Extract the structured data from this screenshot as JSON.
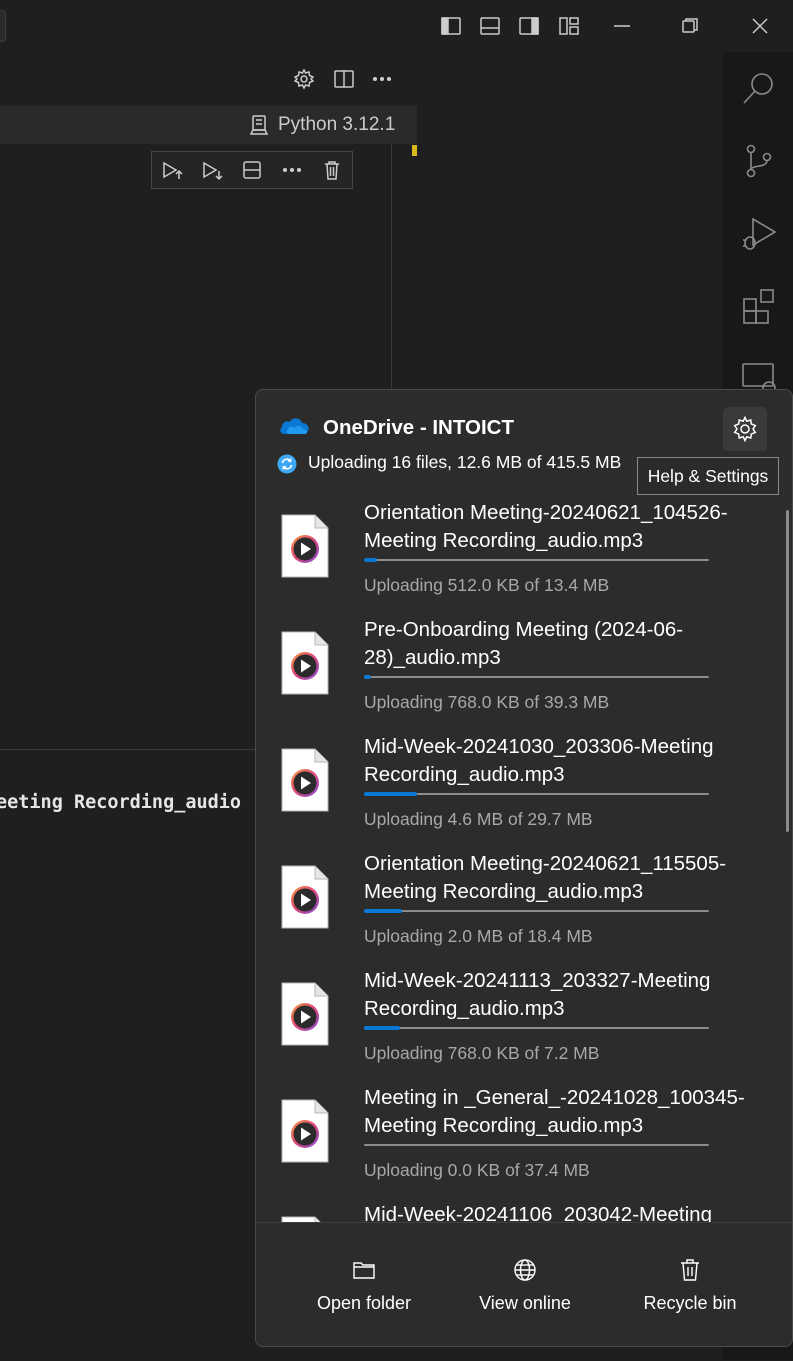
{
  "vscode": {
    "kernel_label": "Python 3.12.1",
    "output_fragment": "eeting Recording_audio"
  },
  "onedrive": {
    "title": "OneDrive - INTOICT",
    "status": "Uploading 16 files, 12.6 MB of 415.5 MB",
    "settings_tooltip": "Help & Settings",
    "files": [
      {
        "name": "Orientation Meeting-20240621_104526-Meeting Recording_audio.mp3",
        "status": "Uploading 512.0 KB of 13.4 MB",
        "progress": 0.037
      },
      {
        "name": "Pre-Onboarding Meeting (2024-06-28)_audio.mp3",
        "status": "Uploading 768.0 KB of 39.3 MB",
        "progress": 0.019
      },
      {
        "name": "Mid-Week-20241030_203306-Meeting Recording_audio.mp3",
        "status": "Uploading 4.6 MB of 29.7 MB",
        "progress": 0.155
      },
      {
        "name": "Orientation Meeting-20240621_115505-Meeting Recording_audio.mp3",
        "status": "Uploading 2.0 MB of 18.4 MB",
        "progress": 0.109
      },
      {
        "name": "Mid-Week-20241113_203327-Meeting Recording_audio.mp3",
        "status": "Uploading 768.0 KB of 7.2 MB",
        "progress": 0.104
      },
      {
        "name": "Meeting in _General_-20241028_100345-Meeting Recording_audio.mp3",
        "status": "Uploading 0.0 KB of 37.4 MB",
        "progress": 0
      },
      {
        "name": "Mid-Week-20241106_203042-Meeting",
        "status": "",
        "progress": 0
      }
    ],
    "actions": {
      "open_folder": "Open folder",
      "view_online": "View online",
      "recycle_bin": "Recycle bin"
    }
  },
  "colors": {
    "accent": "#0a78d4",
    "minimap_marker": "#d7ba1c"
  }
}
